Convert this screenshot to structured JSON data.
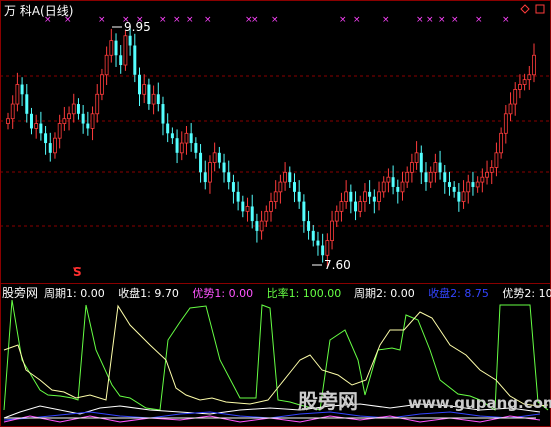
{
  "title": "万  科A(日线)",
  "colors": {
    "up": "#ff3c3c",
    "down": "#54ffff",
    "grid": "#8a0000",
    "period1": "#ffffff",
    "close1": "#ffffff",
    "adv1": "#ff55ff",
    "ratio": "#66ff44",
    "period2": "#ffffff",
    "close2": "#3344ff",
    "adv2": "#ffffff",
    "marker": "#ff44ff",
    "axis_label": "#ffffff",
    "watermark": "#cccccc",
    "sell": "#ff3030"
  },
  "top_labels": {
    "high": "9.95",
    "low": "7.60"
  },
  "sell_marker": "S",
  "indicator_header": {
    "name": "股旁网",
    "items": [
      {
        "label": "周期1: 0.00",
        "color_key": "period1"
      },
      {
        "label": "收盘1: 9.70",
        "color_key": "close1"
      },
      {
        "label": "优势1: 0.00",
        "color_key": "adv1"
      },
      {
        "label": "比率1: 100.00",
        "color_key": "ratio"
      },
      {
        "label": "周期2: 0.00",
        "color_key": "period2"
      },
      {
        "label": "收盘2: 8.75",
        "color_key": "close2"
      },
      {
        "label": "优势2: 10.00",
        "color_key": "adv2"
      }
    ]
  },
  "watermark": {
    "cn": "股旁网",
    "url": "www.gupang.com"
  },
  "chart_data": {
    "type": "candlestick",
    "price_high": 9.95,
    "price_low": 7.6,
    "close_series": [
      9.05,
      9.2,
      9.4,
      9.3,
      9.1,
      8.95,
      9.0,
      8.9,
      8.8,
      8.7,
      8.85,
      9.0,
      9.05,
      9.1,
      9.2,
      9.1,
      9.0,
      8.95,
      9.1,
      9.3,
      9.5,
      9.7,
      9.85,
      9.7,
      9.6,
      9.9,
      9.8,
      9.5,
      9.3,
      9.4,
      9.2,
      9.3,
      9.2,
      9.0,
      8.9,
      8.85,
      8.7,
      8.8,
      8.9,
      8.8,
      8.7,
      8.5,
      8.4,
      8.6,
      8.7,
      8.6,
      8.5,
      8.4,
      8.3,
      8.2,
      8.1,
      8.15,
      8.0,
      7.9,
      8.0,
      8.1,
      8.2,
      8.3,
      8.4,
      8.5,
      8.4,
      8.3,
      8.2,
      8.0,
      7.9,
      7.8,
      7.75,
      7.65,
      7.8,
      8.0,
      8.1,
      8.2,
      8.3,
      8.2,
      8.1,
      8.2,
      8.3,
      8.25,
      8.2,
      8.3,
      8.4,
      8.45,
      8.35,
      8.3,
      8.4,
      8.5,
      8.6,
      8.7,
      8.5,
      8.4,
      8.5,
      8.6,
      8.5,
      8.4,
      8.35,
      8.3,
      8.2,
      8.3,
      8.4,
      8.35,
      8.4,
      8.45,
      8.5,
      8.55,
      8.7,
      8.9,
      9.1,
      9.2,
      9.35,
      9.4,
      9.45,
      9.5,
      9.7
    ]
  }
}
